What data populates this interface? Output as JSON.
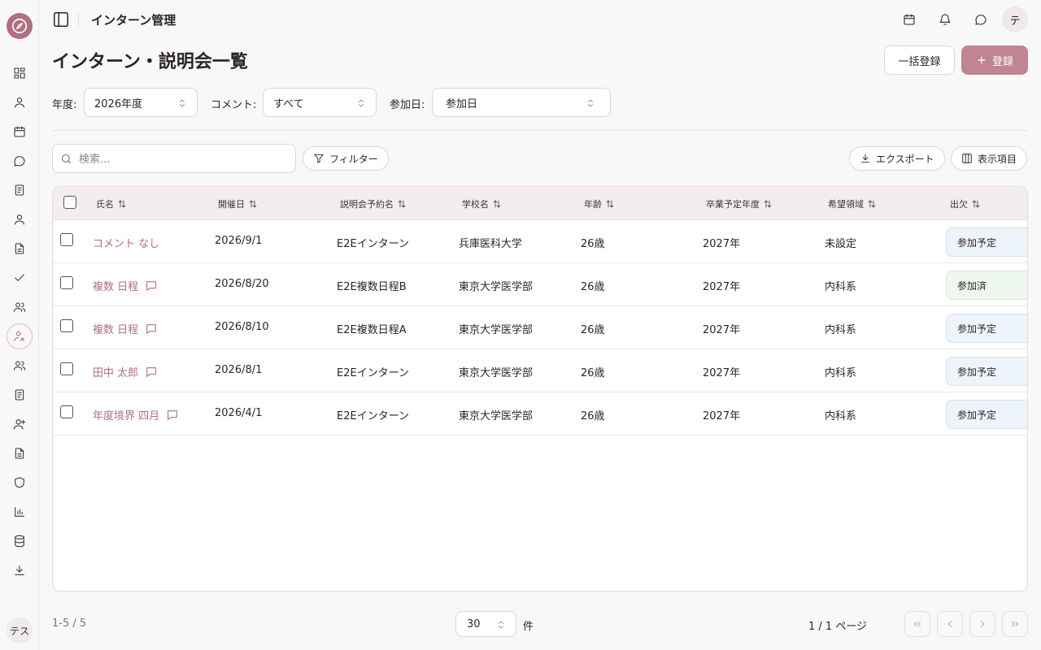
{
  "header": {
    "app_title": "インターン管理",
    "user_initial": "テ"
  },
  "sidebar": {
    "user_label": "テス"
  },
  "page": {
    "title": "インターン・説明会一覧",
    "bulk_register_label": "一括登録",
    "register_label": "登録"
  },
  "filters": {
    "year_label": "年度:",
    "year_value": "2026年度",
    "comment_label": "コメント:",
    "comment_value": "すべて",
    "date_label": "参加日:",
    "date_value": "参加日"
  },
  "toolbar": {
    "search_placeholder": "検索...",
    "filter_label": "フィルター",
    "export_label": "エクスポート",
    "columns_label": "表示項目"
  },
  "table": {
    "columns": [
      "氏名",
      "開催日",
      "説明会予約名",
      "学校名",
      "年齢",
      "卒業予定年度",
      "希望領域",
      "出欠"
    ],
    "rows": [
      {
        "name": "コメント なし",
        "has_comment": false,
        "date": "2026/9/1",
        "event": "E2Eインターン",
        "school": "兵庫医科大学",
        "age": "26歳",
        "grad": "2027年",
        "field": "未設定",
        "status": "参加予定"
      },
      {
        "name": "複数 日程",
        "has_comment": true,
        "date": "2026/8/20",
        "event": "E2E複数日程B",
        "school": "東京大学医学部",
        "age": "26歳",
        "grad": "2027年",
        "field": "内科系",
        "status": "参加済"
      },
      {
        "name": "複数 日程",
        "has_comment": true,
        "date": "2026/8/10",
        "event": "E2E複数日程A",
        "school": "東京大学医学部",
        "age": "26歳",
        "grad": "2027年",
        "field": "内科系",
        "status": "参加予定"
      },
      {
        "name": "田中 太郎",
        "has_comment": true,
        "date": "2026/8/1",
        "event": "E2Eインターン",
        "school": "東京大学医学部",
        "age": "26歳",
        "grad": "2027年",
        "field": "内科系",
        "status": "参加予定"
      },
      {
        "name": "年度境界 四月",
        "has_comment": true,
        "date": "2026/4/1",
        "event": "E2Eインターン",
        "school": "東京大学医学部",
        "age": "26歳",
        "grad": "2027年",
        "field": "内科系",
        "status": "参加予定"
      }
    ]
  },
  "pagination": {
    "count_text": "1-5 / 5",
    "per_page_value": "30",
    "per_page_unit": "件",
    "page_info": "1 / 1 ページ"
  },
  "colors": {
    "accent": "#c08493",
    "name_link": "#b06e80",
    "status_planned_bg": "#eef4fb",
    "status_done_bg": "#eef8f0"
  }
}
